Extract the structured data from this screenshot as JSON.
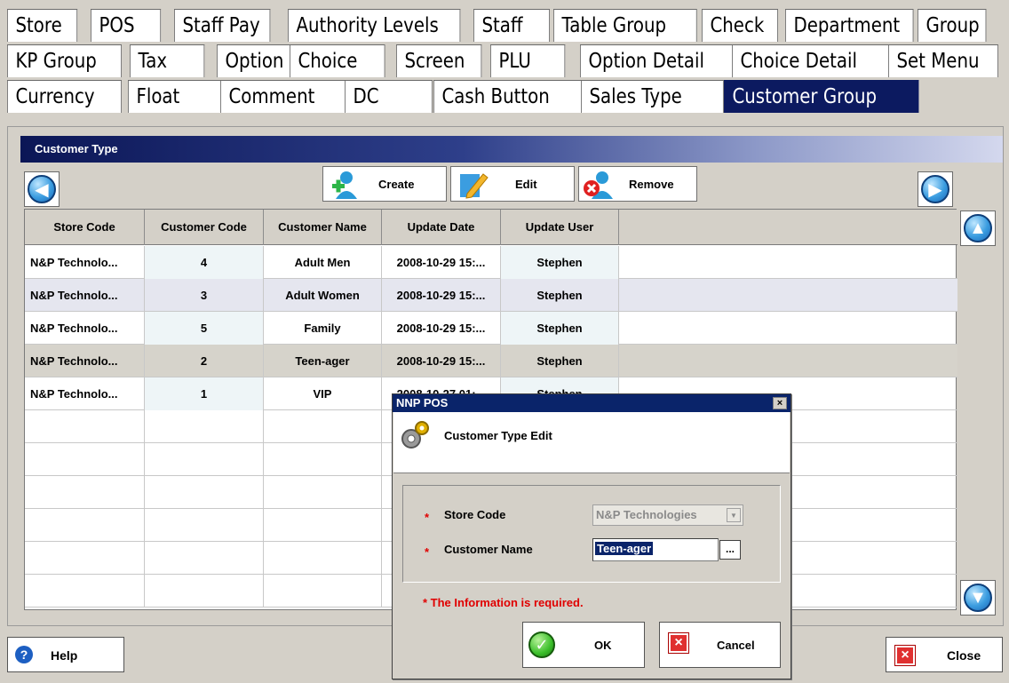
{
  "tabs": {
    "row1": [
      "Store",
      "POS",
      "Staff Pay",
      "Authority Levels",
      "Staff",
      "Table Group",
      "Check",
      "Department",
      "Group"
    ],
    "row2": [
      "KP Group",
      "Tax",
      "Option",
      "Choice",
      "Screen",
      "PLU",
      "Option Detail",
      "Choice Detail",
      "Set Menu"
    ],
    "row3": [
      "Currency",
      "Float",
      "Comment",
      "DC",
      "Cash Button",
      "Sales Type",
      "Customer Group"
    ],
    "active": "Customer Group"
  },
  "panel": {
    "title": "Customer Type"
  },
  "toolbar": {
    "create_label": "Create",
    "edit_label": "Edit",
    "remove_label": "Remove"
  },
  "grid": {
    "columns": [
      "Store Code",
      "Customer Code",
      "Customer Name",
      "Update Date",
      "Update User"
    ],
    "rows": [
      [
        "N&P Technolo...",
        "4",
        "Adult Men",
        "2008-10-29 15:...",
        "Stephen"
      ],
      [
        "N&P Technolo...",
        "3",
        "Adult Women",
        "2008-10-29 15:...",
        "Stephen"
      ],
      [
        "N&P Technolo...",
        "5",
        "Family",
        "2008-10-29 15:...",
        "Stephen"
      ],
      [
        "N&P Technolo...",
        "2",
        "Teen-ager",
        "2008-10-29 15:...",
        "Stephen"
      ],
      [
        "N&P Technolo...",
        "1",
        "VIP",
        "2008-10-27 01:...",
        "Stephen"
      ]
    ],
    "selected_row": 3
  },
  "footer": {
    "help_label": "Help",
    "close_label": "Close"
  },
  "dialog": {
    "title": "NNP POS",
    "close_glyph": "×",
    "heading": "Customer Type Edit",
    "store_code_label": "Store Code",
    "store_code_value": "N&P Technologies",
    "customer_name_label": "Customer Name",
    "customer_name_value": "Teen-ager",
    "browse_label": "...",
    "required_note": "* The Information is required.",
    "ok_label": "OK",
    "cancel_label": "Cancel"
  },
  "colors": {
    "active_tab": "#0c1a60",
    "title_bar": "#0a246a",
    "required": "#e00000",
    "row_tint_a": "#eef5f7",
    "row_tint_b": "#e5e6ef",
    "row_selected": "#d6d3cb"
  },
  "icons": [
    "arrow-left-icon",
    "arrow-right-icon",
    "arrow-up-icon",
    "arrow-down-icon",
    "create-user-icon",
    "edit-pencil-icon",
    "remove-user-icon",
    "help-icon",
    "close-x-icon",
    "gear-icon",
    "ok-check-icon",
    "cancel-x-icon"
  ]
}
